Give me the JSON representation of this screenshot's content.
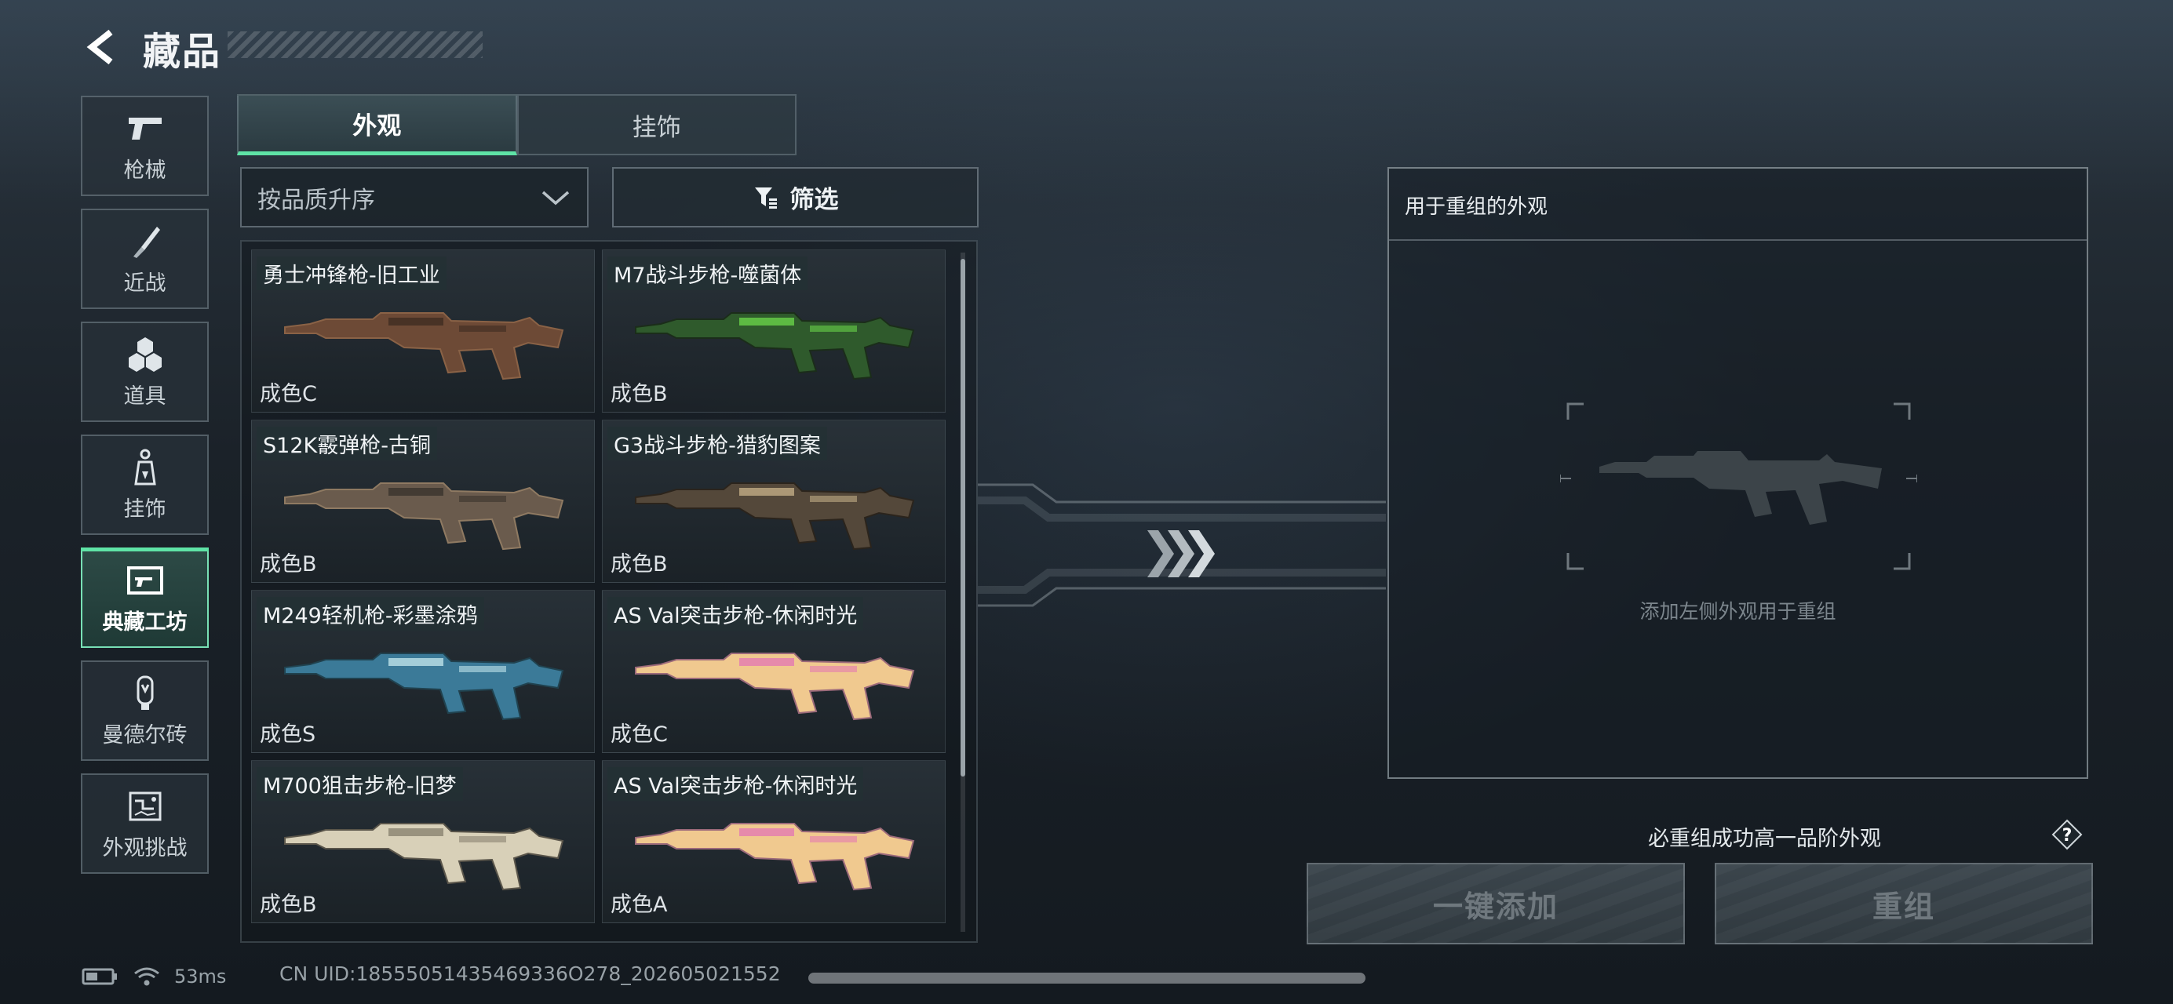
{
  "header": {
    "title": "藏品"
  },
  "nav": {
    "items": [
      {
        "label": "枪械",
        "icon": "pistol-icon"
      },
      {
        "label": "近战",
        "icon": "knife-icon"
      },
      {
        "label": "道具",
        "icon": "grenades-icon"
      },
      {
        "label": "挂饰",
        "icon": "charm-icon"
      },
      {
        "label": "典藏工坊",
        "icon": "workshop-icon",
        "active": true
      },
      {
        "label": "曼德尔砖",
        "icon": "mandel-brick-icon"
      },
      {
        "label": "外观挑战",
        "icon": "challenge-map-icon"
      }
    ]
  },
  "tabs": [
    {
      "label": "外观",
      "active": true
    },
    {
      "label": "挂饰"
    }
  ],
  "sort": {
    "value": "按品质升序"
  },
  "filter": {
    "label": "筛选"
  },
  "items": [
    {
      "name": "勇士冲锋枪-旧工业",
      "quality": "成色C",
      "skin": "rust"
    },
    {
      "name": "M7战斗步枪-噬菌体",
      "quality": "成色B",
      "skin": "green"
    },
    {
      "name": "S12K霰弹枪-古铜",
      "quality": "成色B",
      "skin": "bronze"
    },
    {
      "name": "G3战斗步枪-猎豹图案",
      "quality": "成色B",
      "skin": "leopard"
    },
    {
      "name": "M249轻机枪-彩墨涂鸦",
      "quality": "成色S",
      "skin": "graffiti"
    },
    {
      "name": "AS Val突击步枪-休闲时光",
      "quality": "成色C",
      "skin": "pastel"
    },
    {
      "name": "M700狙击步枪-旧梦",
      "quality": "成色B",
      "skin": "cream"
    },
    {
      "name": "AS Val突击步枪-休闲时光",
      "quality": "成色A",
      "skin": "pastel"
    }
  ],
  "panel": {
    "title": "用于重组的外观",
    "placeholder": "添加左侧外观用于重组"
  },
  "rule_note": "必重组成功高一品阶外观",
  "buttons": {
    "add_all": "一键添加",
    "recombine": "重组"
  },
  "status": {
    "ping": "53ms",
    "uid": "CN UID:18555051435469336O278_202605021552"
  },
  "colors": {
    "accent": "#5fe3a6",
    "panel_border": "#bec8ce"
  }
}
